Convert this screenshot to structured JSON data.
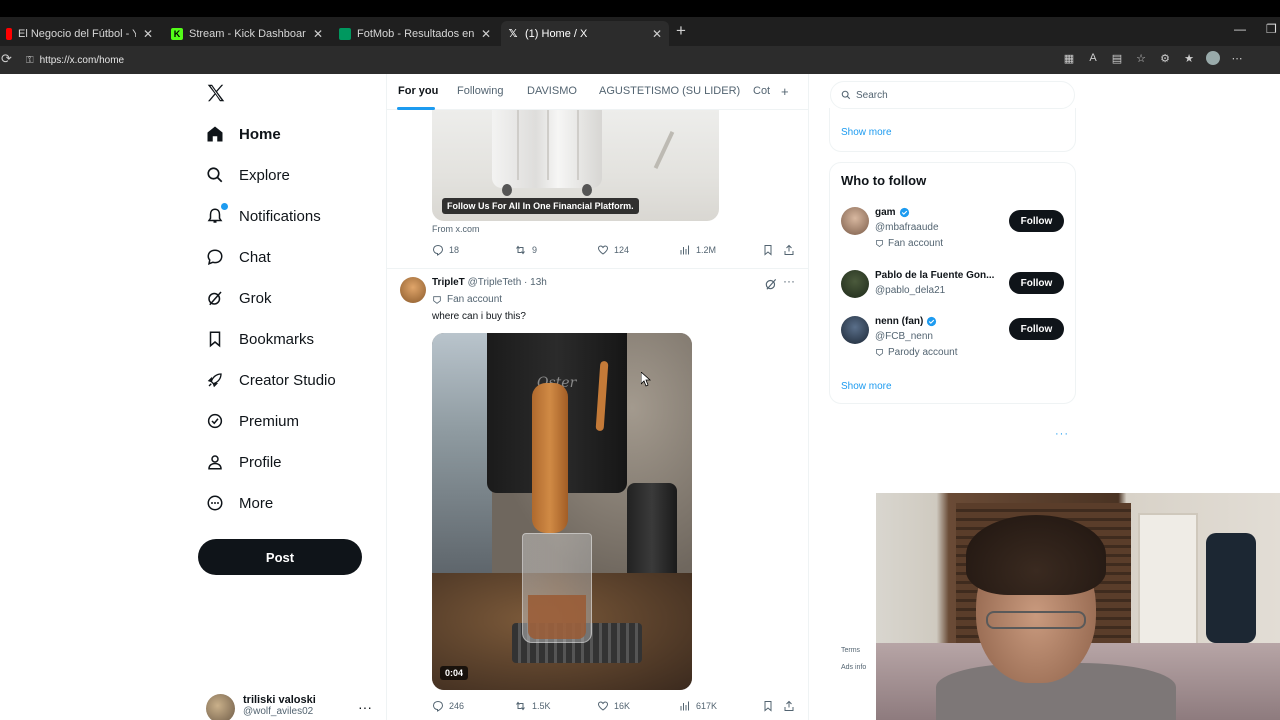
{
  "browser": {
    "tabs": [
      {
        "title": "El Negocio del Fútbol - YouTube",
        "favicon_color": "#ff0000"
      },
      {
        "title": "Stream - Kick Dashboard",
        "favicon_color": "#53fc18",
        "favicon_text": "K"
      },
      {
        "title": "FotMob - Resultados en vivo de fútbol",
        "favicon_color": "#00985f"
      },
      {
        "title": "(1) Home / X",
        "favicon_color": "#ffffff"
      }
    ],
    "url": "https://x.com/home"
  },
  "nav": {
    "items": [
      {
        "label": "Home",
        "icon": "home-icon"
      },
      {
        "label": "Explore",
        "icon": "search-icon"
      },
      {
        "label": "Notifications",
        "icon": "bell-icon"
      },
      {
        "label": "Chat",
        "icon": "chat-icon"
      },
      {
        "label": "Grok",
        "icon": "grok-icon"
      },
      {
        "label": "Bookmarks",
        "icon": "bookmark-icon"
      },
      {
        "label": "Creator Studio",
        "icon": "rocket-icon"
      },
      {
        "label": "Premium",
        "icon": "premium-icon"
      },
      {
        "label": "Profile",
        "icon": "person-icon"
      },
      {
        "label": "More",
        "icon": "more-circle-icon"
      }
    ],
    "notifications_badge": "1",
    "post_label": "Post",
    "account": {
      "name": "triliski valoski",
      "handle": "@wolf_aviles02"
    }
  },
  "feed": {
    "tabs": [
      "For you",
      "Following",
      "DAVISMO",
      "AGUSTETISMO (SU LIDER)",
      "Cot"
    ],
    "active_tab": "For you",
    "tweet1": {
      "media_caption": "Follow Us For All In One Financial Platform.",
      "from": "From x.com",
      "replies": "18",
      "reposts": "9",
      "likes": "124",
      "views": "1.2M"
    },
    "tweet2": {
      "name": "TripleT",
      "handle": "@TripleTeth",
      "time": "· 13h",
      "label": "Fan account",
      "text": "where can i buy this?",
      "video_brand": "Oster",
      "video_duration": "0:04",
      "replies": "246",
      "reposts": "1.5K",
      "likes": "16K",
      "views": "617K"
    }
  },
  "sidebar": {
    "search_placeholder": "Search",
    "show_more_top": "Show more",
    "who_to_follow": {
      "title": "Who to follow",
      "users": [
        {
          "name": "gam",
          "handle": "@mbafraaude",
          "tag": "Fan account",
          "verified": true,
          "button": "Follow"
        },
        {
          "name": "Pablo de la Fuente Gon...",
          "handle": "@pablo_dela21",
          "tag": "",
          "verified": false,
          "button": "Follow"
        },
        {
          "name": "nenn (fan)",
          "handle": "@FCB_nenn",
          "tag": "Parody account",
          "verified": true,
          "button": "Follow"
        }
      ],
      "show_more": "Show more"
    },
    "footer": {
      "terms": "Terms",
      "ads_info": "Ads info"
    }
  },
  "colors": {
    "accent": "#1d9bf0",
    "text": "#0f1419",
    "muted": "#536471",
    "border": "#eff3f4"
  }
}
